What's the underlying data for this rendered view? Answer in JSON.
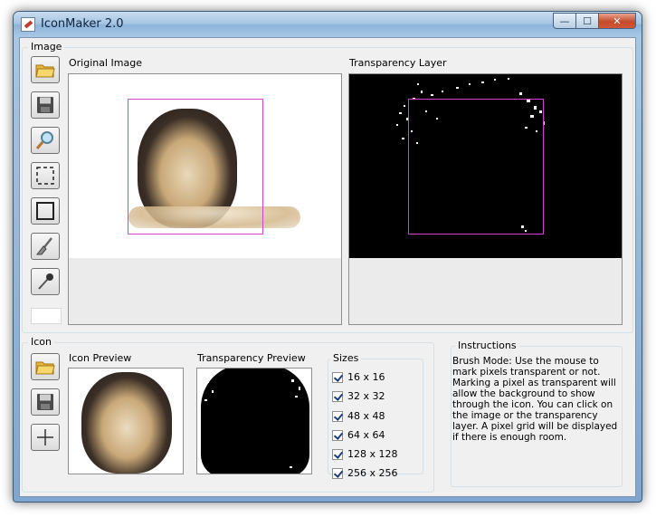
{
  "window": {
    "title": "IconMaker 2.0",
    "controls": {
      "minimize": "—",
      "maximize": "☐",
      "close": "✕"
    }
  },
  "image_group": {
    "label": "Image",
    "original_label": "Original Image",
    "transparency_label": "Transparency Layer",
    "tools": [
      {
        "name": "open-image-button",
        "icon": "folder-icon"
      },
      {
        "name": "save-image-button",
        "icon": "floppy-disk-icon"
      },
      {
        "name": "zoom-button",
        "icon": "magnifier-icon"
      },
      {
        "name": "select-region-button",
        "icon": "dashed-selection-icon"
      },
      {
        "name": "crop-region-button",
        "icon": "rectangle-icon"
      },
      {
        "name": "brush-tool-button",
        "icon": "brush-icon"
      },
      {
        "name": "color-picker-button",
        "icon": "eyedropper-icon"
      }
    ]
  },
  "icon_group": {
    "label": "Icon",
    "preview_label": "Icon Preview",
    "transparency_preview_label": "Transparency Preview",
    "tools": [
      {
        "name": "open-icon-button",
        "icon": "folder-icon"
      },
      {
        "name": "save-icon-button",
        "icon": "floppy-disk-icon"
      },
      {
        "name": "add-size-button",
        "icon": "plus-icon"
      }
    ]
  },
  "sizes": {
    "label": "Sizes",
    "items": [
      {
        "label": "16 x 16",
        "checked": true
      },
      {
        "label": "32 x 32",
        "checked": true
      },
      {
        "label": "48 x 48",
        "checked": true
      },
      {
        "label": "64 x 64",
        "checked": true
      },
      {
        "label": "128 x 128",
        "checked": true
      },
      {
        "label": "256 x 256",
        "checked": true
      }
    ]
  },
  "instructions": {
    "label": "Instructions",
    "text": "Brush Mode: Use the mouse to mark pixels transparent or not. Marking a pixel as transparent will allow the background to show through the icon. You can click on the image or the transparency layer. A pixel grid will be displayed if there is enough room."
  },
  "colors": {
    "selection": "#d43fd4",
    "mask_background": "#000000",
    "client_background": "#f0f0f0"
  }
}
